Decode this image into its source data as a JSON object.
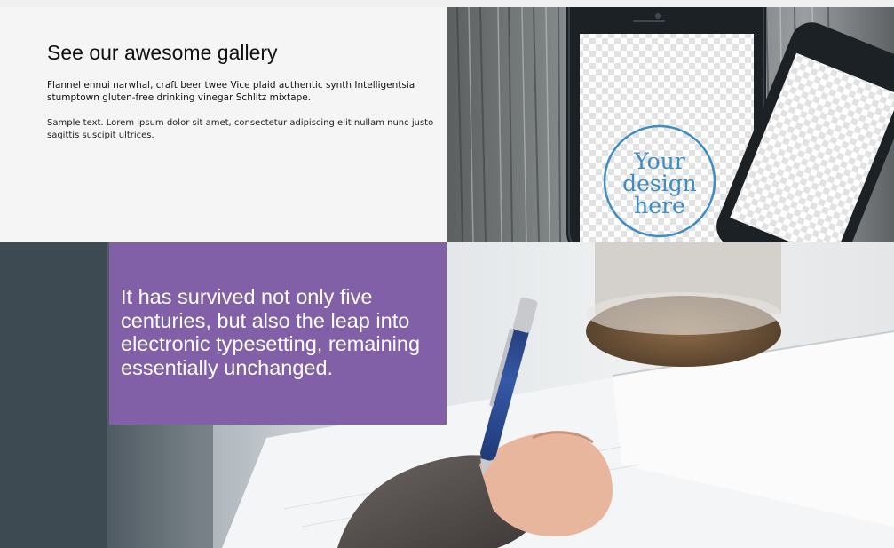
{
  "gallery": {
    "title": "See our awesome gallery",
    "paragraph_1": "Flannel ennui narwhal, craft beer twee Vice plaid authentic synth Intelligentsia stumptown gluten-free drinking vinegar Schlitz mixtape.",
    "paragraph_2": "Sample text. Lorem ipsum dolor sit amet, consectetur adipiscing elit nullam nunc justo sagittis suscipit ultrices.",
    "image_badge_lines": [
      "Your",
      "design",
      "here"
    ]
  },
  "hero": {
    "quote": "It has survived not only five centuries, but also the leap into electronic typesetting, remaining essentially unchanged."
  },
  "colors": {
    "gallery_bg": "#f5f5f5",
    "quote_card_bg": "#8260a8",
    "hero_dark": "#3e4a52",
    "badge_blue": "#3d8cc4"
  }
}
